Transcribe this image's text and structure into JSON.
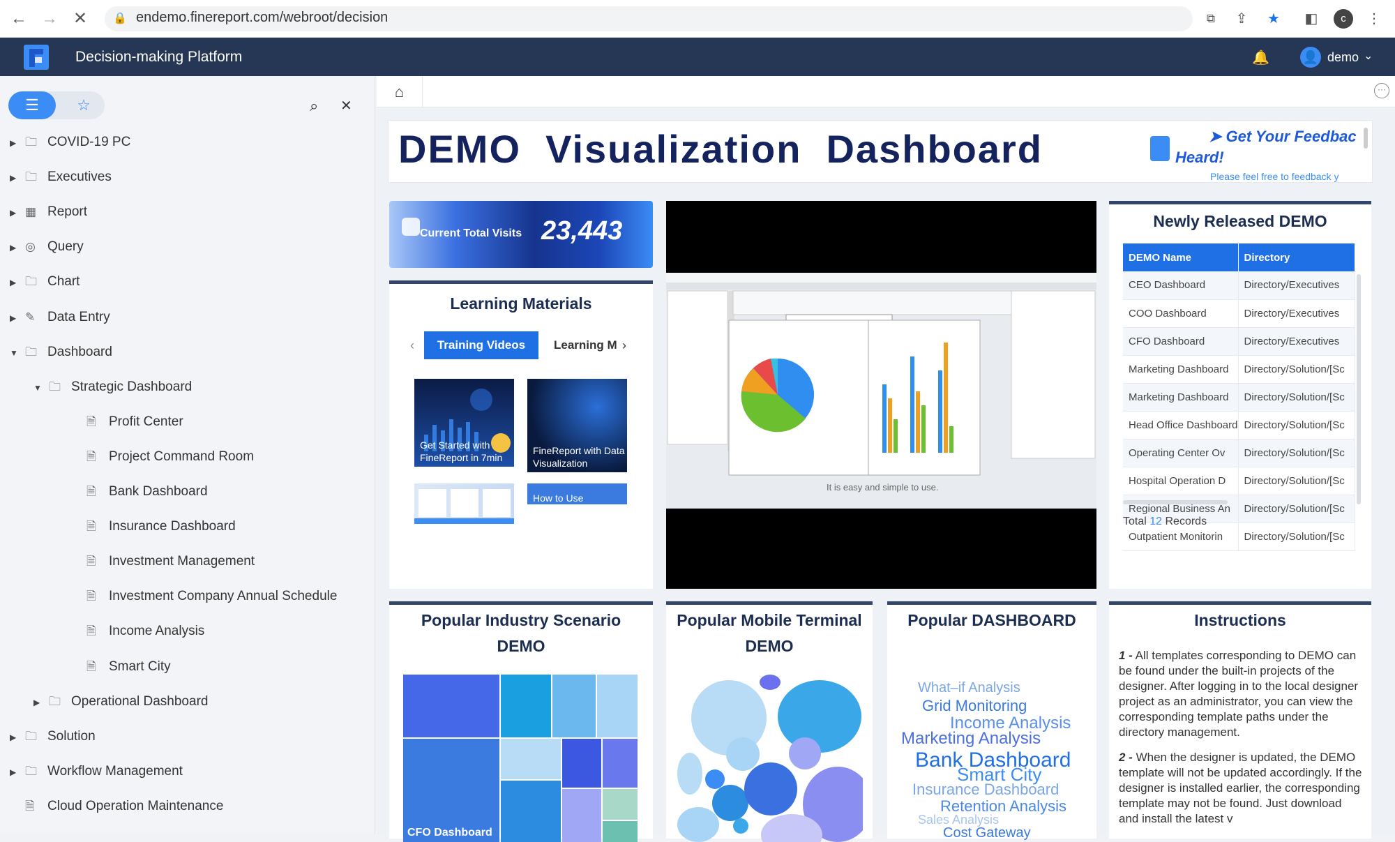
{
  "browser": {
    "url": "endemo.finereport.com/webroot/decision",
    "profile_initial": "c"
  },
  "app": {
    "title": "Decision-making Platform",
    "user": "demo"
  },
  "sidebar": {
    "items": [
      {
        "label": "COVID-19 PC",
        "level": 0,
        "type": "folder",
        "expand": "collapsed"
      },
      {
        "label": "Executives",
        "level": 0,
        "type": "folder",
        "expand": "collapsed"
      },
      {
        "label": "Report",
        "level": 0,
        "type": "report",
        "expand": "collapsed"
      },
      {
        "label": "Query",
        "level": 0,
        "type": "query",
        "expand": "collapsed"
      },
      {
        "label": "Chart",
        "level": 0,
        "type": "folder",
        "expand": "collapsed"
      },
      {
        "label": "Data Entry",
        "level": 0,
        "type": "entry",
        "expand": "collapsed"
      },
      {
        "label": "Dashboard",
        "level": 0,
        "type": "folder",
        "expand": "expanded"
      },
      {
        "label": "Strategic Dashboard",
        "level": 1,
        "type": "folder",
        "expand": "expanded"
      },
      {
        "label": "Profit Center",
        "level": 2,
        "type": "file",
        "expand": "none"
      },
      {
        "label": "Project Command Room",
        "level": 2,
        "type": "file",
        "expand": "none"
      },
      {
        "label": "Bank Dashboard",
        "level": 2,
        "type": "file",
        "expand": "none"
      },
      {
        "label": "Insurance Dashboard",
        "level": 2,
        "type": "file",
        "expand": "none"
      },
      {
        "label": "Investment Management",
        "level": 2,
        "type": "file",
        "expand": "none"
      },
      {
        "label": "Investment Company Annual Schedule",
        "level": 2,
        "type": "file",
        "expand": "none"
      },
      {
        "label": "Income Analysis",
        "level": 2,
        "type": "file",
        "expand": "none"
      },
      {
        "label": "Smart City",
        "level": 2,
        "type": "file",
        "expand": "none"
      },
      {
        "label": "Operational Dashboard",
        "level": 1,
        "type": "folder",
        "expand": "collapsed"
      },
      {
        "label": "Solution",
        "level": 0,
        "type": "folder",
        "expand": "collapsed"
      },
      {
        "label": "Workflow Management",
        "level": 0,
        "type": "folder",
        "expand": "collapsed"
      },
      {
        "label": "Cloud Operation Maintenance",
        "level": 0,
        "type": "file",
        "expand": "none"
      }
    ]
  },
  "dashboard": {
    "title": "DEMO  Visualization  Dashboard",
    "feedback": {
      "line1": "➤ Get Your Feedbac",
      "line2": "Heard!",
      "line3": "Please feel free to feedback y"
    },
    "visits": {
      "label": "Current Total Visits",
      "value": "23,443"
    },
    "learning": {
      "title": "Learning Materials",
      "tabs": [
        "Training Videos",
        "Learning M"
      ],
      "thumbs": [
        "Get Started with FineReport in 7min",
        "FineReport with Data Visualization",
        "",
        "How to Use"
      ]
    },
    "video": {
      "caption": "It is easy and simple to use."
    },
    "new_demo": {
      "title": "Newly Released DEMO",
      "columns": [
        "DEMO Name",
        "Directory"
      ],
      "rows": [
        [
          "CEO Dashboard",
          "Directory/Executives"
        ],
        [
          "COO Dashboard",
          "Directory/Executives"
        ],
        [
          "CFO Dashboard",
          "Directory/Executives"
        ],
        [
          "Marketing Dashboard",
          "Directory/Solution/[Sc"
        ],
        [
          "Marketing Dashboard",
          "Directory/Solution/[Sc"
        ],
        [
          "Head Office Dashboard",
          "Directory/Solution/[Sc"
        ],
        [
          "Operating Center Ov",
          "Directory/Solution/[Sc"
        ],
        [
          "Hospital Operation D",
          "Directory/Solution/[Sc"
        ],
        [
          "Regional Business An",
          "Directory/Solution/[Sc"
        ],
        [
          "Outpatient Monitorin",
          "Directory/Solution/[Sc"
        ]
      ],
      "total_prefix": "Total",
      "total_count": "12",
      "total_suffix": "Records"
    },
    "industry": {
      "title": "Popular Industry Scenario DEMO",
      "tile_label": "CFO Dashboard"
    },
    "mobile": {
      "title": "Popular Mobile Terminal DEMO"
    },
    "popular": {
      "title": "Popular DASHBOARD",
      "words": [
        {
          "text": "What–if Analysis",
          "color": "#7aa6e8"
        },
        {
          "text": "Grid Monitoring",
          "color": "#3b7be0"
        },
        {
          "text": "Income Analysis",
          "color": "#5b8ee8"
        },
        {
          "text": "Marketing Analysis",
          "color": "#4a6fe0"
        },
        {
          "text": "Bank Dashboard",
          "color": "#1f6fe5"
        },
        {
          "text": "Smart City",
          "color": "#3b8cf5"
        },
        {
          "text": "Insurance Dashboard",
          "color": "#7aa6e8"
        },
        {
          "text": "Retention Analysis",
          "color": "#4a88e8"
        },
        {
          "text": "Sales Analysis",
          "color": "#a9c4f0"
        },
        {
          "text": "Cost Gateway",
          "color": "#3b7be0"
        }
      ]
    },
    "instructions": {
      "title": "Instructions",
      "p1_num": "1 -",
      "p1": " All templates corresponding to DEMO can be found under the built-in projects of the designer. After logging in to the local designer project as an administrator, you can view the corresponding template paths under the directory management.",
      "p2_num": "2 -",
      "p2": " When the designer is updated, the DEMO template will not be updated accordingly. If the designer is installed earlier, the corresponding template may not be found. Just download and install the latest v"
    }
  }
}
